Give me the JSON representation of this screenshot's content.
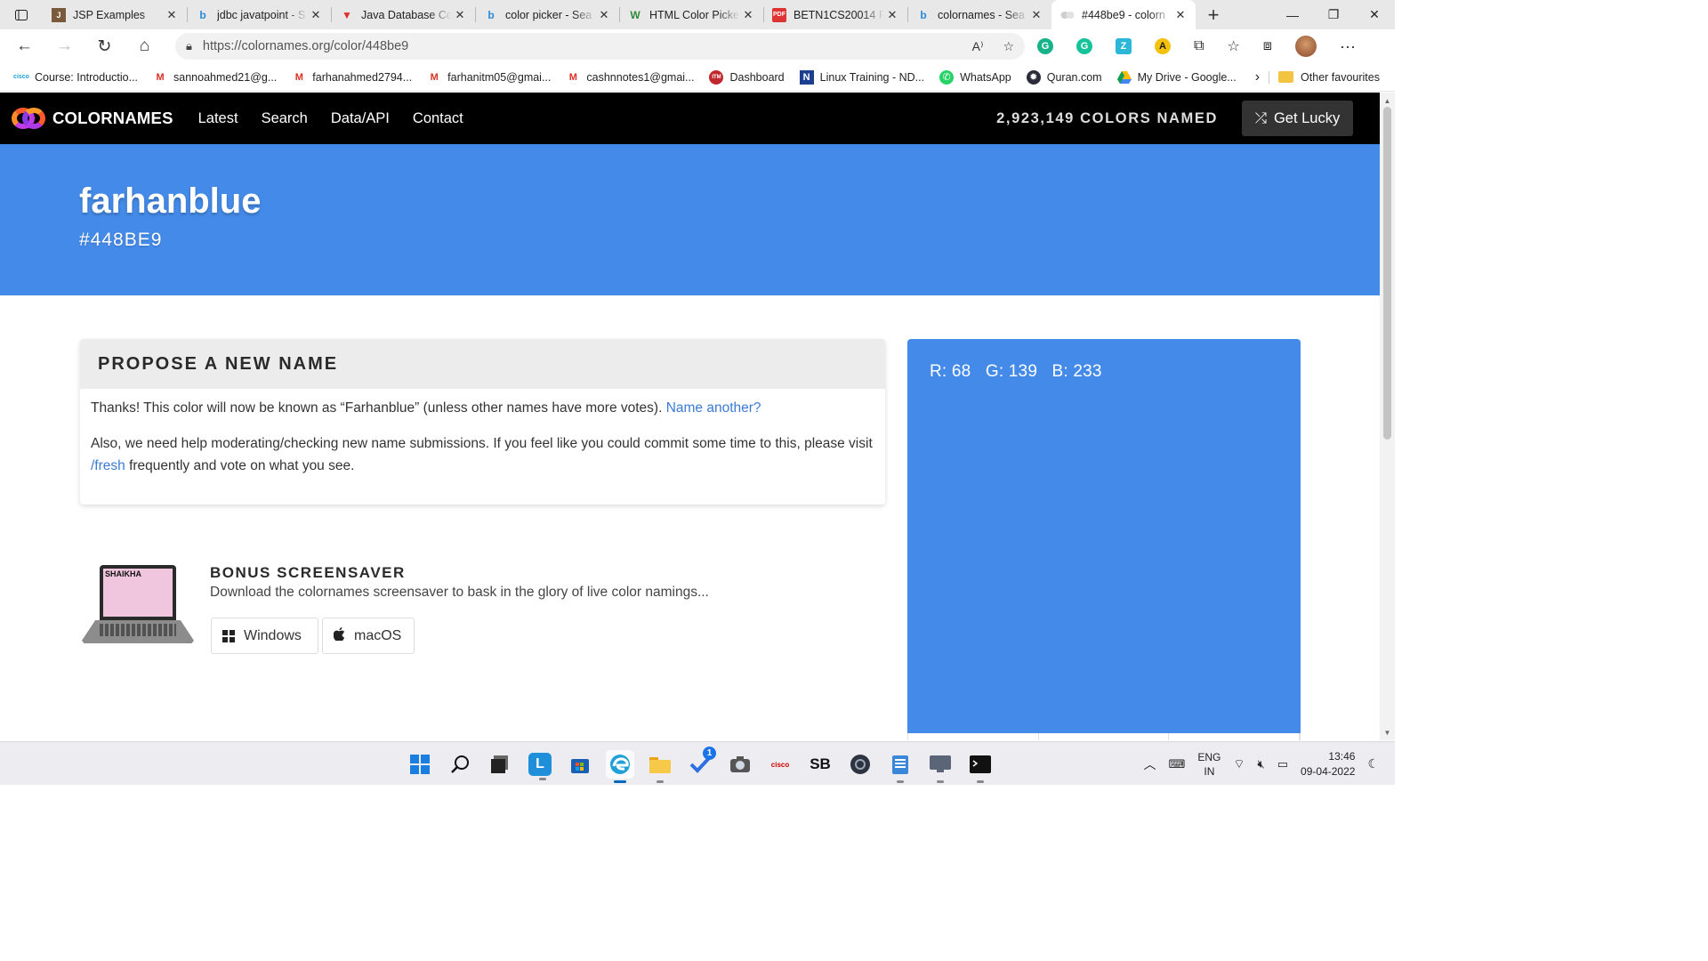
{
  "browser": {
    "tabs": [
      {
        "title": "JSP Examples",
        "icon": "jsp-icon"
      },
      {
        "title": "jdbc javatpoint - S",
        "icon": "bing-icon"
      },
      {
        "title": "Java Database Co",
        "icon": "vivaldi-icon"
      },
      {
        "title": "color picker - Sea",
        "icon": "bing-icon"
      },
      {
        "title": "HTML Color Picke",
        "icon": "w3schools-icon"
      },
      {
        "title": "BETN1CS20014 F",
        "icon": "pdf-icon"
      },
      {
        "title": "colornames - Sea",
        "icon": "bing-icon"
      },
      {
        "title": "#448be9 - colorn",
        "icon": "colornames-icon",
        "active": true
      }
    ],
    "url": "https://colornames.org/color/448be9",
    "bookmarks": [
      {
        "label": "Course: Introductio...",
        "icon": "cisco-icon"
      },
      {
        "label": "sannoahmed21@g...",
        "icon": "gmail-icon"
      },
      {
        "label": "farhanahmed2794...",
        "icon": "gmail-icon"
      },
      {
        "label": "farhanitm05@gmai...",
        "icon": "gmail-icon"
      },
      {
        "label": "cashnnotes1@gmai...",
        "icon": "gmail-icon"
      },
      {
        "label": "Dashboard",
        "icon": "itm-icon"
      },
      {
        "label": "Linux Training - ND...",
        "icon": "n-icon"
      },
      {
        "label": "WhatsApp",
        "icon": "whatsapp-icon"
      },
      {
        "label": "Quran.com",
        "icon": "quran-icon"
      },
      {
        "label": "My Drive - Google...",
        "icon": "google-drive-icon"
      }
    ],
    "other_favourites": "Other favourites"
  },
  "site": {
    "logo_text": "COLORNAMES",
    "nav": [
      "Latest",
      "Search",
      "Data/API",
      "Contact"
    ],
    "colors_named": "2,923,149 COLORS NAMED",
    "get_lucky": "Get Lucky"
  },
  "color": {
    "name": "farhanblue",
    "hex": "#448BE9",
    "rgb_text": "R: 68   G: 139   B: 233",
    "swatch_color": "#448be9"
  },
  "propose": {
    "heading": "PROPOSE A NEW NAME",
    "thanks_text": "Thanks! This color will now be known as “Farhanblue” (unless other names have more votes). ",
    "name_another_link": "Name another?",
    "help_text_1": "Also, we need help moderating/checking new name submissions. If you feel like you could commit some time to this, please visit ",
    "fresh_link": "/fresh",
    "help_text_2": " frequently and vote on what you see."
  },
  "bonus": {
    "heading": "BONUS SCREENSAVER",
    "description": "Download the colornames screensaver to bask in the glory of live color namings...",
    "windows_button": "Windows",
    "macos_button": "macOS",
    "laptop_brand": "SHAIKHA"
  },
  "taskbar": {
    "icons": [
      "windows-start-icon",
      "search-icon",
      "task-view-icon",
      "l-app-icon",
      "store-icon",
      "edge-icon",
      "file-explorer-icon",
      "todo-icon",
      "camera-icon",
      "cisco-icon",
      "sb-icon",
      "settings-gear-icon",
      "notepad-icon",
      "sql-icon",
      "terminal-icon"
    ],
    "todo_badge": "1",
    "lang_line1": "ENG",
    "lang_line2": "IN",
    "time": "13:46",
    "date": "09-04-2022"
  }
}
